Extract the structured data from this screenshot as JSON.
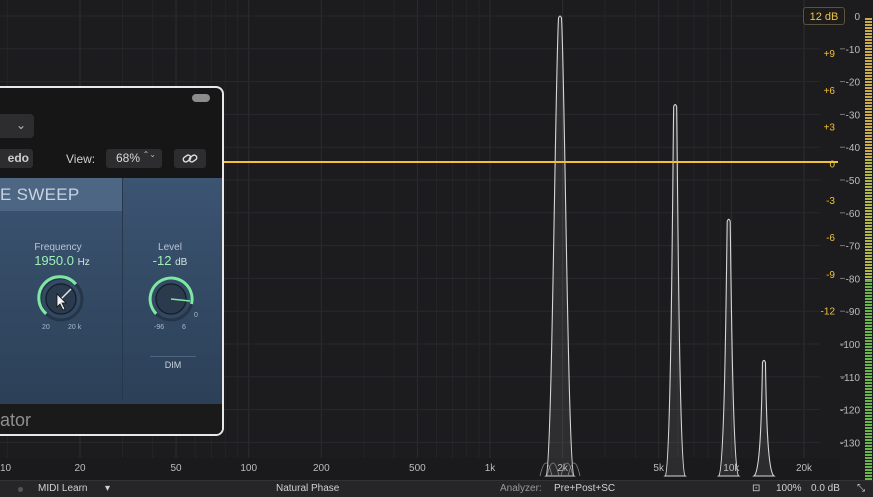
{
  "plugin": {
    "preset_chevron": "⌄",
    "redo_label": "edo",
    "view_label": "View:",
    "view_value": "68%",
    "view_arrows": "⌃⌄",
    "panel_title": "E SWEEP",
    "frequency": {
      "label": "Frequency",
      "value": "1950.0",
      "unit": "Hz",
      "min": "20",
      "max": "20 k"
    },
    "level": {
      "label": "Level",
      "value": "-12",
      "unit": "dB",
      "min": "-96",
      "max": "6",
      "zero": "0"
    },
    "dim_label": "DIM",
    "footer_title": "ator"
  },
  "analyzer": {
    "gain_badge": "12 dB",
    "eq_scale": [
      "+9",
      "+6",
      "+3",
      "0",
      "-3",
      "-6",
      "-9",
      "-12"
    ],
    "db_scale": [
      "0",
      "-10",
      "-20",
      "-30",
      "-40",
      "-50",
      "-60",
      "-70",
      "-80",
      "-90",
      "-100",
      "-110",
      "-120",
      "-130"
    ],
    "freq_labels": [
      "20",
      "50",
      "100",
      "200",
      "500",
      "1k",
      "2k",
      "5k",
      "10k",
      "20k"
    ],
    "left_edge_label": "10",
    "peaks_hz": [
      1950,
      5850,
      9750,
      13650
    ],
    "peak_levels_db": [
      0,
      -27,
      -62,
      -105
    ],
    "colors": {
      "eq_line": "#f0c23b",
      "scale_eq": "#f0c23b",
      "scale_db": "#bdbdbd"
    }
  },
  "status": {
    "midi_learn": "MIDI Learn",
    "midi_arrow": "▾",
    "phase_mode": "Natural Phase",
    "analyzer_label": "Analyzer:",
    "analyzer_value": "Pre+Post+SC",
    "zoom": "100%",
    "gain": "0.0 dB"
  }
}
